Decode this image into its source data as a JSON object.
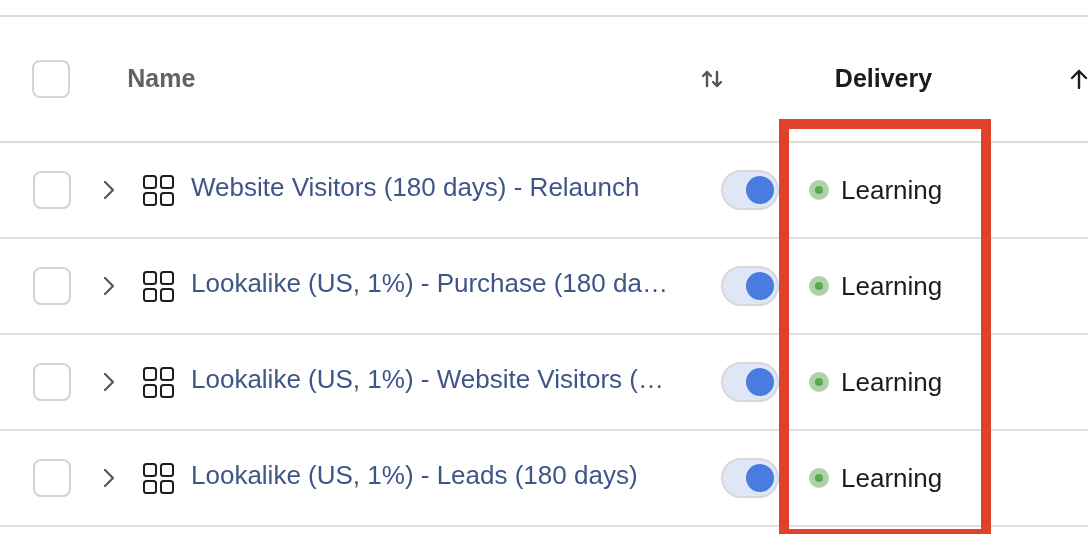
{
  "table": {
    "select_all_checked": false,
    "delivery_highlighted": true,
    "columns": [
      {
        "label": "Name",
        "kind": "sortable"
      },
      {
        "label": "Delivery",
        "kind": "sorted-asc"
      }
    ],
    "rows": [
      {
        "checked": false,
        "expanded": false,
        "name": "Website Visitors (180 days) - Relaunch",
        "on": true,
        "delivery": "Learning",
        "color": "#5aa854"
      },
      {
        "checked": false,
        "expanded": false,
        "name": "Lookalike (US, 1%) - Purchase (180 da…",
        "on": true,
        "delivery": "Learning",
        "color": "#5aa854"
      },
      {
        "checked": false,
        "expanded": false,
        "name": "Lookalike (US, 1%) - Website Visitors (…",
        "on": true,
        "delivery": "Learning",
        "color": "#5aa854"
      },
      {
        "checked": false,
        "expanded": false,
        "name": "Lookalike (US, 1%) - Leads (180 days)",
        "on": true,
        "delivery": "Learning",
        "color": "#5aa854"
      }
    ]
  }
}
